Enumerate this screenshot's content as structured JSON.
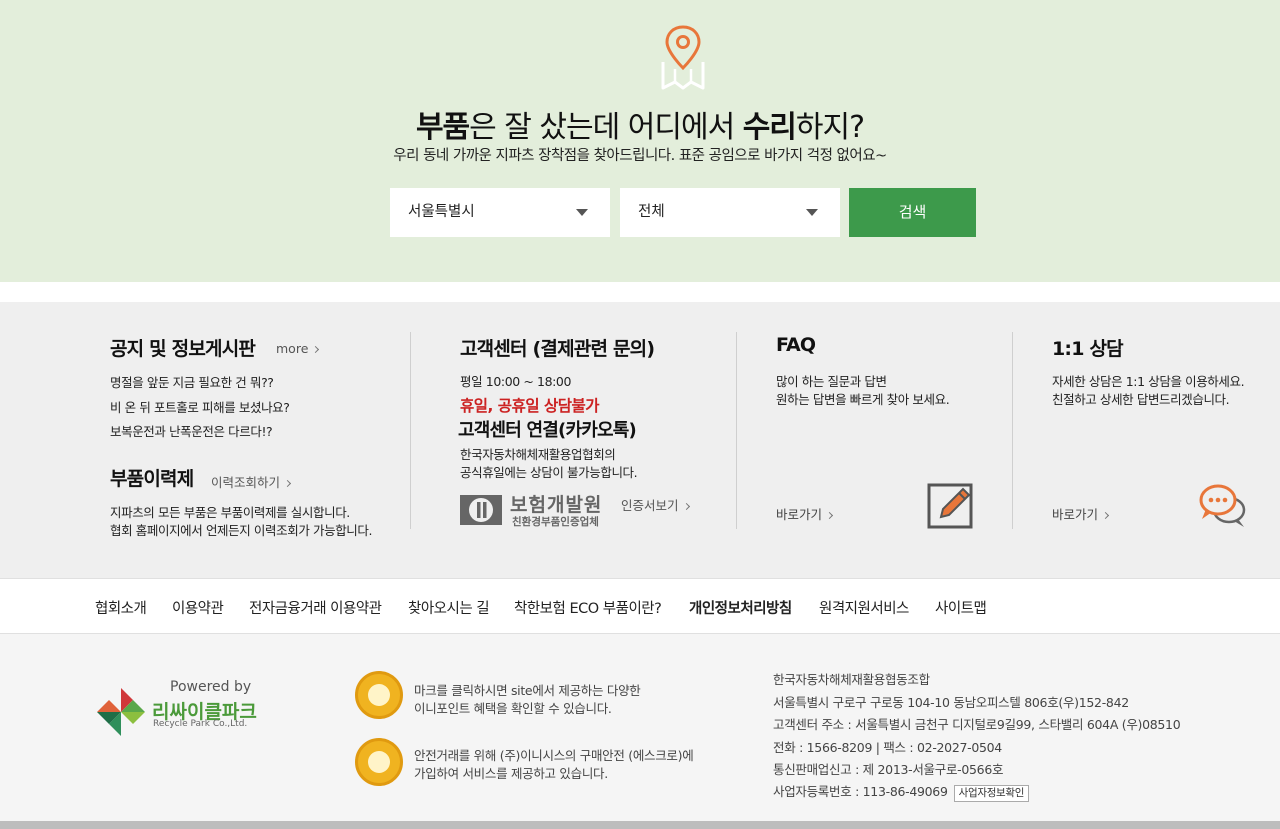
{
  "hero": {
    "title_b1": "부품",
    "title_t1": "은 잘 샀는데 어디에서 ",
    "title_b2": "수리",
    "title_t2": "하지?",
    "subtitle": "우리 동네 가까운 지파츠 장착점을 찾아드립니다. 표준 공임으로 바가지 걱정 없어요~",
    "region_select": "서울특별시",
    "district_select": "전체",
    "search_button": "검색"
  },
  "notice": {
    "title": "공지 및 정보게시판",
    "more": "more",
    "items": [
      "명절을 앞둔 지금 필요한 건 뭐??",
      "비 온 뒤 포트홀로 피해를 보셨나요?",
      "보복운전과 난폭운전은 다르다!?"
    ],
    "history_title": "부품이력제",
    "history_link": "이력조회하기",
    "history_desc1": "지파츠의 모든 부품은 부품이력제를 실시합니다.",
    "history_desc2": "협회 홈페이지에서 언제든지 이력조회가 가능합니다."
  },
  "customer": {
    "title": "고객센터 (결제관련 문의)",
    "hours": "평일 10:00 ~ 18:00",
    "closed": "휴일, 공휴일 상담불가",
    "kakao_title": "고객센터 연결(카카오톡)",
    "kakao_desc1": "한국자동차해체재활용업협회의",
    "kakao_desc2": "공식휴일에는 상담이 불가능합니다.",
    "cert_name": "보험개발원",
    "cert_sub": "친환경부품인증업체",
    "cert_link": "인증서보기"
  },
  "faq": {
    "title": "FAQ",
    "desc1": "많이 하는 질문과 답변",
    "desc2": "원하는 답변을 빠르게 찾아 보세요.",
    "link": "바로가기"
  },
  "qna": {
    "title": "1:1 상담",
    "desc1": "자세한 상담은 1:1 상담을 이용하세요.",
    "desc2": "친절하고 상세한 답변드리겠습니다.",
    "link": "바로가기"
  },
  "footer_nav": [
    "협회소개",
    "이용약관",
    "전자금융거래 이용약관",
    "찾아오시는 길",
    "착한보험 ECO 부품이란?",
    "개인정보처리방침",
    "원격지원서비스",
    "사이트맵"
  ],
  "footer": {
    "powered_by": "Powered by",
    "brand_kr": "리싸이클파크",
    "brand_en": "Recycle Park Co.,Ltd.",
    "inipoint_1": "마크를 클릭하시면 site에서 제공하는 다양한",
    "inipoint_2": "이니포인트 혜택을 확인할 수 있습니다.",
    "escrow_1": "안전거래를 위해 (주)이니시스의 구매안전 (에스크로)에",
    "escrow_2": "가입하여 서비스를 제공하고 있습니다.",
    "company": "한국자동차해체재활용협동조합",
    "address": "서울특별시 구로구 구로동 104-10 동남오피스텔 806호(우)152-842",
    "cs_address": "고객센터 주소 : 서울특별시 금천구 디지털로9길99, 스타밸리 604A (우)08510",
    "phone": "전화 : 1566-8209 | 팩스 : 02-2027-0504",
    "mail_order": "통신판매업신고 : 제 2013-서울구로-0566호",
    "biz_no": "사업자등록번호 : 113-86-49069",
    "biz_check": "사업자정보확인"
  },
  "colors": {
    "hero_bg": "#e3eedb",
    "search_btn": "#3d9a4b",
    "closed_text": "#cc2222",
    "icon_orange": "#e8763a"
  }
}
